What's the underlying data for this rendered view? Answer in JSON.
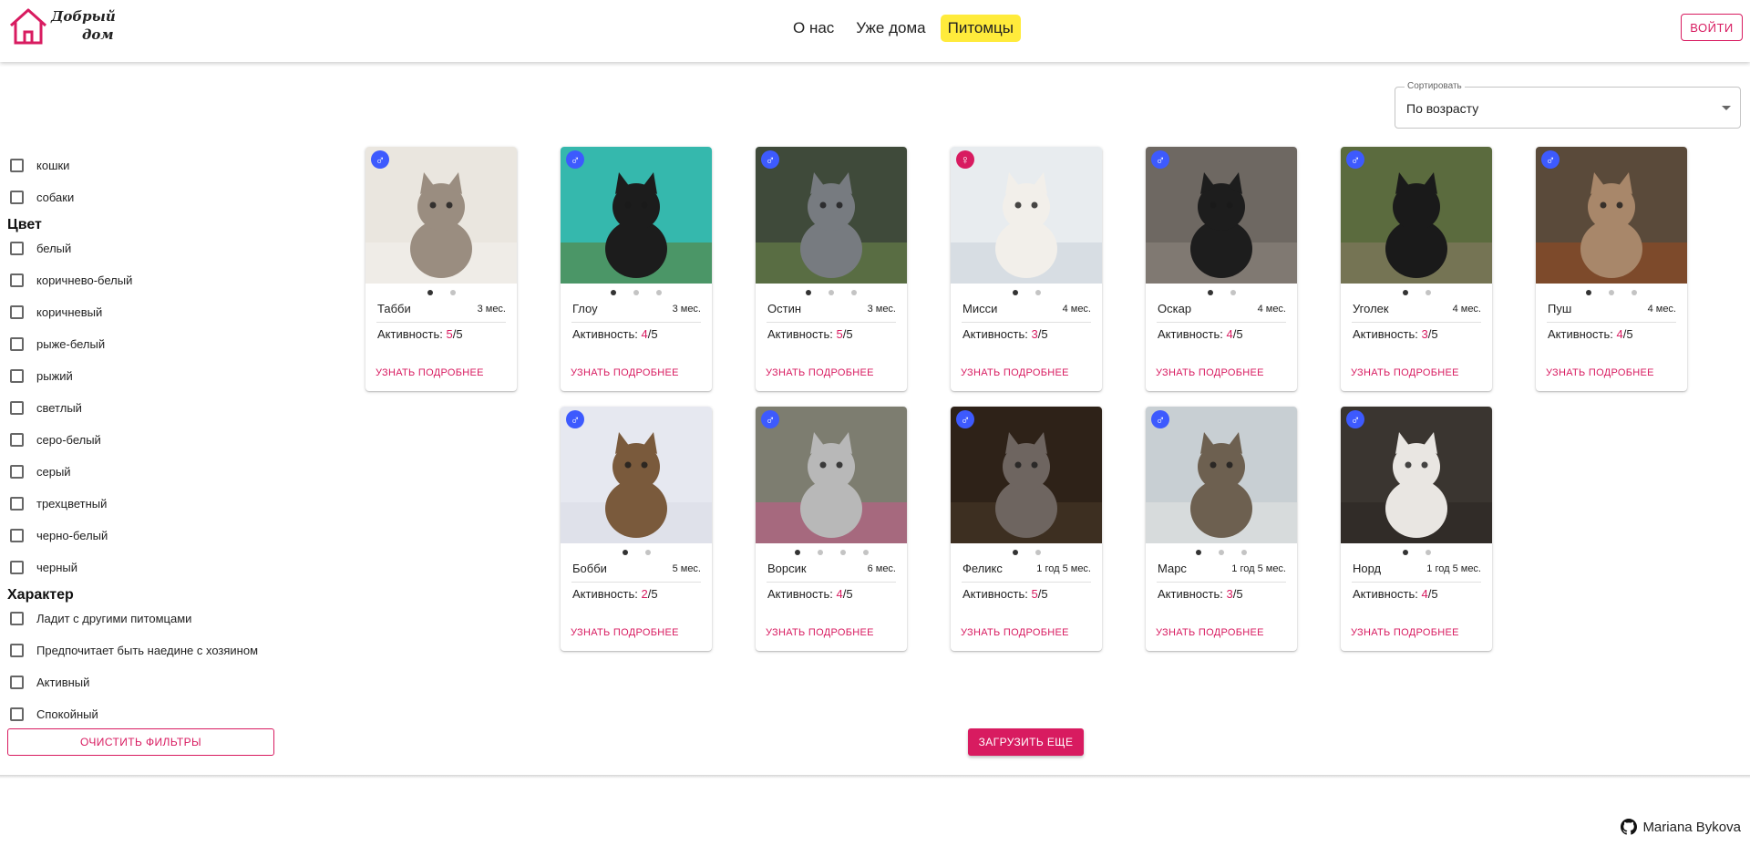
{
  "header": {
    "logo_line1": "Добрый",
    "logo_line2": "дом",
    "logo_icon": "house-icon",
    "nav": [
      {
        "label": "О нас",
        "active": false
      },
      {
        "label": "Уже дома",
        "active": false
      },
      {
        "label": "Питомцы",
        "active": true
      }
    ],
    "login_label": "ВОЙТИ"
  },
  "sort": {
    "label": "Сортировать",
    "value": "По возрасту",
    "icon": "dropdown-arrow-icon"
  },
  "filters": {
    "types": [
      "кошки",
      "собаки"
    ],
    "color_heading": "Цвет",
    "colors": [
      "белый",
      "коричнево-белый",
      "коричневый",
      "рыже-белый",
      "рыжий",
      "светлый",
      "серо-белый",
      "серый",
      "трехцветный",
      "черно-белый",
      "черный"
    ],
    "character_heading": "Характер",
    "characters": [
      "Ладит с другими питомцами",
      "Предпочитает быть наедине с хозяином",
      "Активный",
      "Спокойный"
    ],
    "clear_label": "ОЧИСТИТЬ ФИЛЬТРЫ"
  },
  "card_labels": {
    "activity": "Активность: ",
    "more": "УЗНАТЬ ПОДРОБНЕЕ"
  },
  "pets": [
    {
      "name": "Табби",
      "age": "3 мес.",
      "activity": "5",
      "max": "/5",
      "sex": "male",
      "photos": 2,
      "palette": "#eae6df,#9a8d80,#f3f1ec"
    },
    {
      "name": "Глоу",
      "age": "3 мес.",
      "activity": "4",
      "max": "/5",
      "sex": "male",
      "photos": 3,
      "palette": "#35b8ad,#1c1c1c,#5c7a2e"
    },
    {
      "name": "Остин",
      "age": "3 мес.",
      "activity": "5",
      "max": "/5",
      "sex": "male",
      "photos": 3,
      "palette": "#3f4a3a,#777b80,#6f8b4a"
    },
    {
      "name": "Мисси",
      "age": "4 мес.",
      "activity": "3",
      "max": "/5",
      "sex": "female",
      "photos": 2,
      "palette": "#e8ecef,#f2efea,#c9d2d8"
    },
    {
      "name": "Оскар",
      "age": "4 мес.",
      "activity": "4",
      "max": "/5",
      "sex": "male",
      "photos": 2,
      "palette": "#6e6862,#1d1d1d,#8f8780"
    },
    {
      "name": "Уголек",
      "age": "4 мес.",
      "activity": "3",
      "max": "/5",
      "sex": "male",
      "photos": 2,
      "palette": "#5b6b3e,#1a1a1a,#8a7b66"
    },
    {
      "name": "Пуш",
      "age": "4 мес.",
      "activity": "4",
      "max": "/5",
      "sex": "male",
      "photos": 3,
      "palette": "#5a4a3a,#a8876a,#9b4a1f"
    },
    {
      "name": "Бобби",
      "age": "5 мес.",
      "activity": "2",
      "max": "/5",
      "sex": "male",
      "photos": 2,
      "palette": "#e6e8f0,#7a5a3c,#d8dae5"
    },
    {
      "name": "Ворсик",
      "age": "6 мес.",
      "activity": "4",
      "max": "/5",
      "sex": "male",
      "photos": 4,
      "palette": "#7d7d70,#b8b8b8,#c85a8a"
    },
    {
      "name": "Феликс",
      "age": "1 год 5 мес.",
      "activity": "5",
      "max": "/5",
      "sex": "male",
      "photos": 2,
      "palette": "#2e2218,#6e6560,#4a3a2a"
    },
    {
      "name": "Марс",
      "age": "1 год 5 мес.",
      "activity": "3",
      "max": "/5",
      "sex": "male",
      "photos": 3,
      "palette": "#c8cfd3,#6d6050,#e4e6e3"
    },
    {
      "name": "Норд",
      "age": "1 год 5 мес.",
      "activity": "4",
      "max": "/5",
      "sex": "male",
      "photos": 2,
      "palette": "#3a3530,#e9e6e2,#2a2522"
    }
  ],
  "load_more_label": "ЗАГРУЗИТЬ ЕЩЕ",
  "footer": {
    "author": "Mariana Bykova",
    "icon": "github-icon"
  }
}
